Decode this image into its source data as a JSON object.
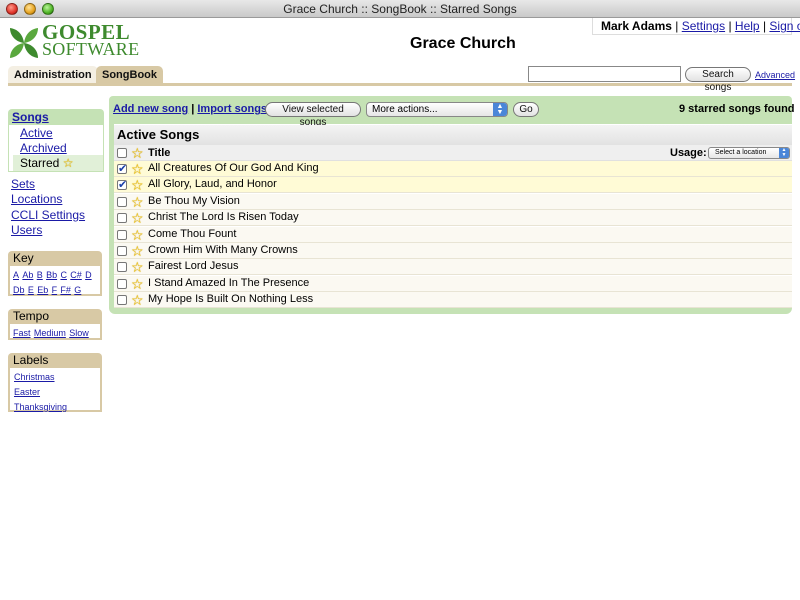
{
  "window": {
    "title": "Grace Church :: SongBook :: Starred Songs"
  },
  "logo": {
    "line1": "GOSPEL",
    "line2": "SOFTWARE"
  },
  "church_name": "Grace Church",
  "userbar": {
    "name": "Mark Adams",
    "sep": "|",
    "settings": "Settings",
    "help": "Help",
    "signout": "Sign out"
  },
  "tabs": {
    "admin": "Administration",
    "songbook": "SongBook"
  },
  "search": {
    "value": "",
    "button": "Search songs",
    "advanced": "Advanced"
  },
  "sidebar": {
    "songs": "Songs",
    "active": "Active",
    "archived": "Archived",
    "starred": "Starred",
    "nav": [
      "Sets",
      "Locations",
      "CCLI Settings",
      "Users"
    ]
  },
  "key_box": {
    "title": "Key",
    "row1": [
      "A",
      "Ab",
      "B",
      "Bb",
      "C",
      "C#",
      "D"
    ],
    "row2": [
      "Db",
      "E",
      "Eb",
      "F",
      "F#",
      "G"
    ]
  },
  "tempo_box": {
    "title": "Tempo",
    "items": [
      "Fast",
      "Medium",
      "Slow"
    ]
  },
  "labels_box": {
    "title": "Labels",
    "items": [
      "Christmas",
      "Easter",
      "Thanksgiving"
    ]
  },
  "toolbar": {
    "add_new": "Add new song",
    "sep": "|",
    "import": "Import songs",
    "view_selected": "View selected songs",
    "more_actions": "More actions...",
    "go": "Go",
    "found": "9 starred songs found"
  },
  "section": {
    "title": "Active Songs",
    "col_title": "Title",
    "usage": "Usage:",
    "location_select": "Select a location"
  },
  "songs": [
    {
      "title": "All Creatures Of Our God And King",
      "checked": true
    },
    {
      "title": "All Glory, Laud, and Honor",
      "checked": true
    },
    {
      "title": "Be Thou My Vision",
      "checked": false
    },
    {
      "title": "Christ The Lord Is Risen Today",
      "checked": false
    },
    {
      "title": "Come Thou Fount",
      "checked": false
    },
    {
      "title": "Crown Him With Many Crowns",
      "checked": false
    },
    {
      "title": "Fairest Lord Jesus",
      "checked": false
    },
    {
      "title": "I Stand Amazed In The Presence",
      "checked": false
    },
    {
      "title": "My Hope Is Built On Nothing Less",
      "checked": false
    }
  ],
  "colors": {
    "accent_green": "#c5e2b5",
    "tan": "#d8c9a5",
    "link": "#1a1aa6",
    "star": "#f2c200",
    "selected_row": "#fffbd6"
  }
}
